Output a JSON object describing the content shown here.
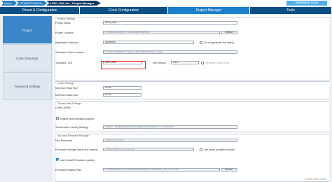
{
  "breadcrumbs": [
    "Home",
    "STM32F103C8Tx",
    "LED1_HAL.ioc - Project Manager"
  ],
  "generate_code": "GENERATE CODE",
  "tabs": [
    "Pinout & Configuration",
    "Clock Configuration",
    "Project Manager",
    "Tools"
  ],
  "left_nav": [
    "Project",
    "Code Generator",
    "Advanced Settings"
  ],
  "project_settings": {
    "title": "Project Settings",
    "project_name_label": "Project Name",
    "project_name": "LED1_HAL",
    "project_location_label": "Project Location",
    "project_location": "E:\\stm32\\Example\\STM32CubeMX\\project",
    "browse": "Browse",
    "app_structure_label": "Application Structure",
    "app_structure": "Advanced",
    "no_generate_main": "Do not generate the main()",
    "toolchain_folder_label": "Toolchain Folder Location",
    "toolchain_folder": "E:\\stm32\\Example\\STM32CubeMX\\project\\LED1_HAL\\",
    "toolchain_ide_label": "Toolchain / IDE",
    "toolchain_ide": "MDK-ARM",
    "min_version_label": "Min Version",
    "min_version": "V5.27",
    "generate_under_root": "Generate Under Root"
  },
  "linker_settings": {
    "title": "Linker Settings",
    "heap_label": "Minimum Heap Size",
    "heap": "0x200",
    "stack_label": "Minimum Stack Size",
    "stack": "0x400"
  },
  "thread_safe": {
    "title": "Thread-safe Settings",
    "cortex": "Cortex-M3NS",
    "enable_multithreaded": "Enable multi-threaded support",
    "locking_label": "Thread-safe Locking Strategy",
    "locking": "Default - Mapping suitable strategy depending on RTOS selection"
  },
  "mcu_firmware": {
    "title": "Mcu and Firmware Package",
    "mcu_ref_label": "Mcu Reference",
    "mcu_ref": "STM32F103C8Tx",
    "fw_label": "Firmware Package Name and Version",
    "fw": "STM32Cube FW_F1 V1.8.5",
    "use_latest": "Use latest available version",
    "use_default_location": "Use Default Firmware Location",
    "fw_path_label": "Firmware Relative Path",
    "fw_path": "C:/Users/Admin/STM32Cube/Repository/STM32Cube_FW_F1_V1.8.5",
    "browse": "Browse"
  },
  "watermark": "CSDN @Tt-Tools"
}
